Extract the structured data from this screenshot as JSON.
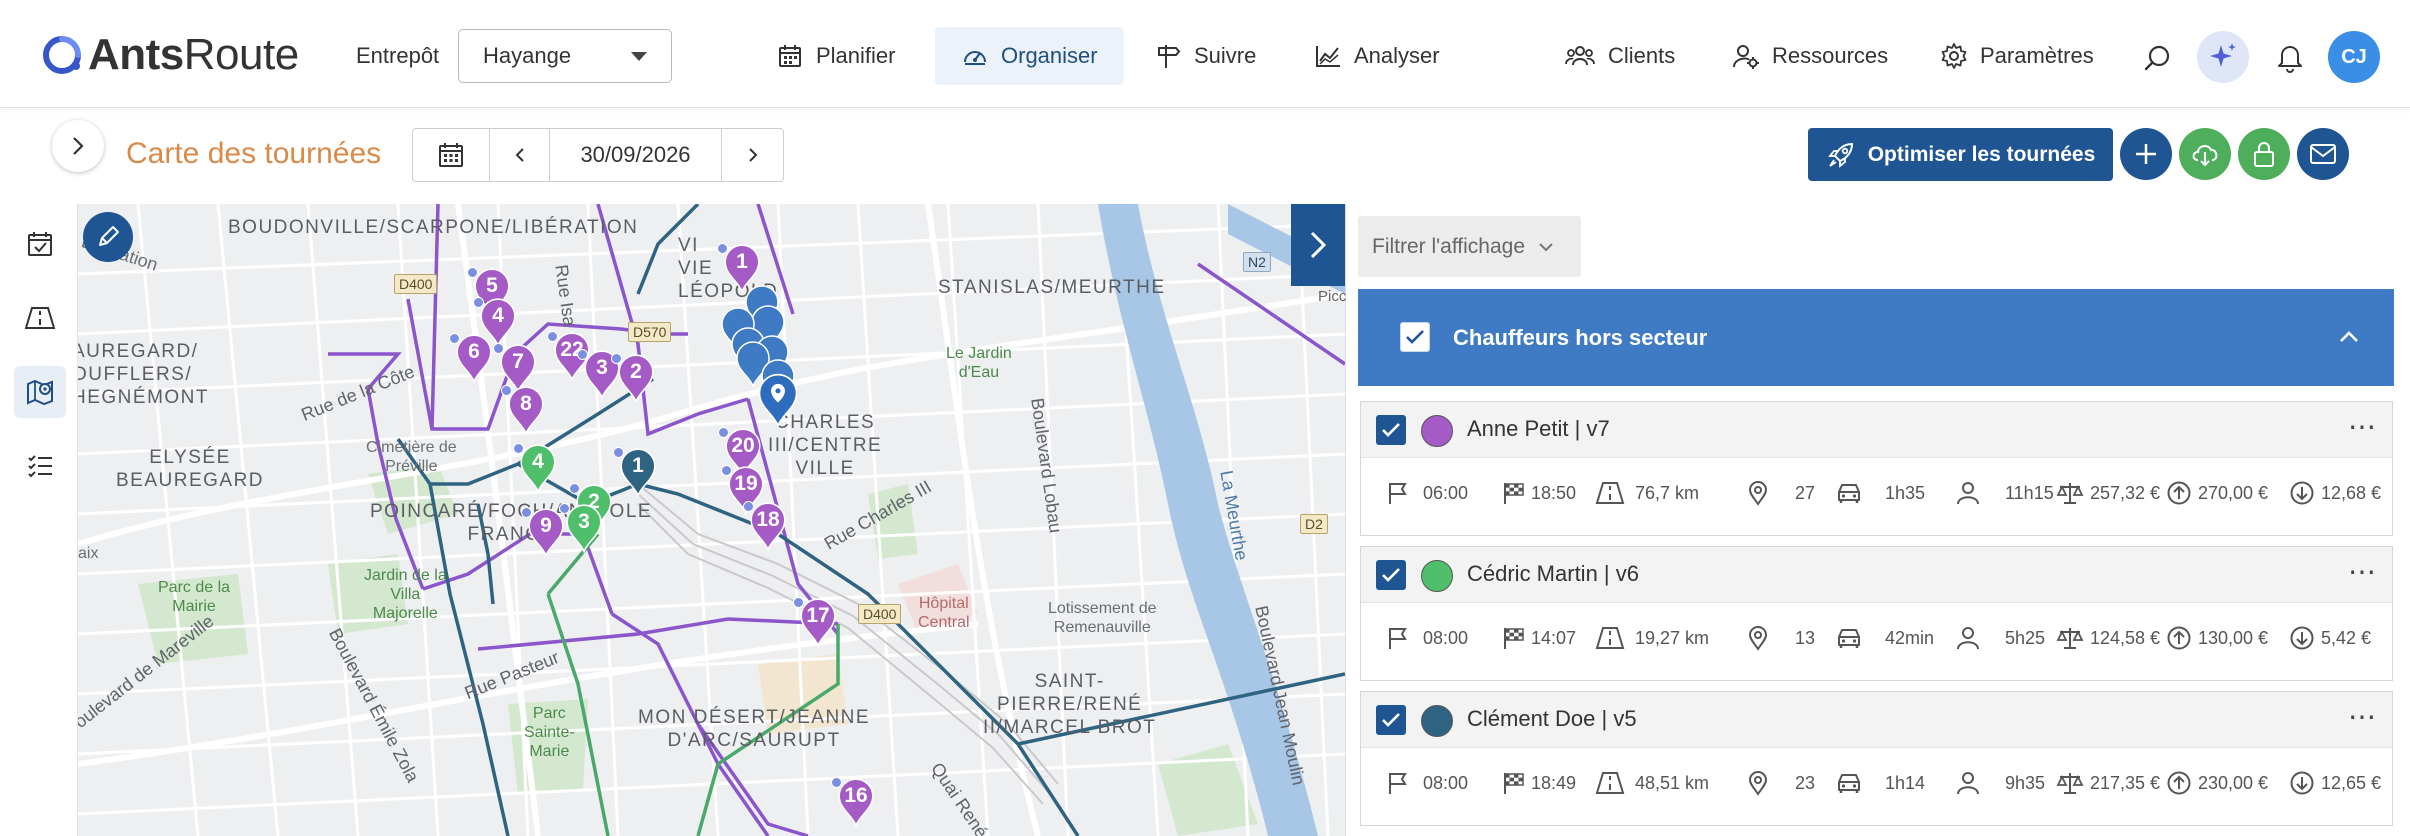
{
  "app": {
    "logo_prefix": "Ants",
    "logo_suffix": "Route"
  },
  "header": {
    "warehouse_label": "Entrepôt",
    "warehouse_value": "Hayange",
    "nav": [
      {
        "label": "Planifier",
        "icon": "calendar-icon"
      },
      {
        "label": "Organiser",
        "icon": "dashboard-icon",
        "active": true
      },
      {
        "label": "Suivre",
        "icon": "signpost-icon"
      },
      {
        "label": "Analyser",
        "icon": "chart-icon"
      },
      {
        "label": "Clients",
        "icon": "users-icon"
      },
      {
        "label": "Ressources",
        "icon": "user-gear-icon"
      },
      {
        "label": "Paramètres",
        "icon": "gear-icon"
      }
    ],
    "avatar_initials": "CJ"
  },
  "toolbar": {
    "page_title": "Carte des tournées",
    "date": "30/09/2026",
    "optimize_label": "Optimiser les tournées"
  },
  "map": {
    "labels": {
      "boudonville": "BOUDONVILLE/SCARPONE/LIBÉRATION",
      "vieille": "VI<br>VIE<br>LÉOPOLD",
      "stanislas": "STANISLAS/MEURTHE",
      "liberation": "Libération",
      "aureg": "AUREGARD/<br>OUFFLERS/<br>HEGNÉMONT",
      "elysee": "ELYSÉE<br>BEAUREGARD",
      "poincare": "POINCARÉ/FOCH/ANATOLE<br>FRANCE",
      "charles": "CHARLES<br>III/CENTRE<br>VILLE",
      "montdesert": "MON DÉSERT/JEANNE<br>D'ARC/SAURUPT",
      "saint_pierre": "SAINT-<br>PIERRE/RENÉ<br>II/MARCEL BROT",
      "rue_cote": "Rue de la Côte",
      "rue_isa": "Rue Isa",
      "cim_preville": "Cimetière de<br>Préville",
      "jardin_villa": "Jardin de la<br>Villa<br>Majorelle",
      "parc_mairie": "Parc de la<br>Mairie",
      "parc_ste_marie": "Parc<br>Sainte-<br>Marie",
      "bd_mareville": "Boulevard de Mareville",
      "bd_zola": "Boulevard Émile Zola",
      "rue_pasteur": "Rue Pasteur",
      "rue_charles": "Rue Charles III",
      "bd_lobau": "Boulevard Lobau",
      "la_meurthe": "La Meurthe",
      "bd_moulin": "Boulevard Jean Moulin",
      "quai_rene": "Quai René",
      "hopital": "Hôpital<br>Central",
      "lotissement": "Lotissement de<br>Remenauville",
      "leparc": "Le Jardin<br>d'Eau",
      "saix": "aix",
      "picc": "Picc"
    },
    "shields": {
      "d400a": "D400",
      "d570": "D570",
      "d400b": "D400",
      "d2": "D2",
      "n2": "N2"
    },
    "markers_purple": [
      "1",
      "5",
      "4",
      "22",
      "6",
      "7",
      "3",
      "2",
      "8",
      "9",
      "20",
      "19",
      "18",
      "17",
      "16"
    ],
    "markers_green": [
      "4",
      "2",
      "3"
    ],
    "markers_teal": [
      "1"
    ]
  },
  "panel": {
    "filter_label": "Filtrer l'affichage",
    "group_title": "Chauffeurs hors secteur",
    "drivers": [
      {
        "name": "Anne Petit | v7",
        "color": "#a45bc6",
        "start": "06:00",
        "end": "18:50",
        "distance": "76,7 km",
        "stops": "27",
        "drive": "1h35",
        "work": "11h15",
        "cost": "257,32 €",
        "revenue": "270,00 €",
        "margin": "12,68 €"
      },
      {
        "name": "Cédric Martin | v6",
        "color": "#4fbf6b",
        "start": "08:00",
        "end": "14:07",
        "distance": "19,27 km",
        "stops": "13",
        "drive": "42min",
        "work": "5h25",
        "cost": "124,58 €",
        "revenue": "130,00 €",
        "margin": "5,42 €"
      },
      {
        "name": "Clément Doe | v5",
        "color": "#2f6382",
        "start": "08:00",
        "end": "18:49",
        "distance": "48,51 km",
        "stops": "23",
        "drive": "1h14",
        "work": "9h35",
        "cost": "217,35 €",
        "revenue": "230,00 €",
        "margin": "12,65 €"
      }
    ]
  }
}
